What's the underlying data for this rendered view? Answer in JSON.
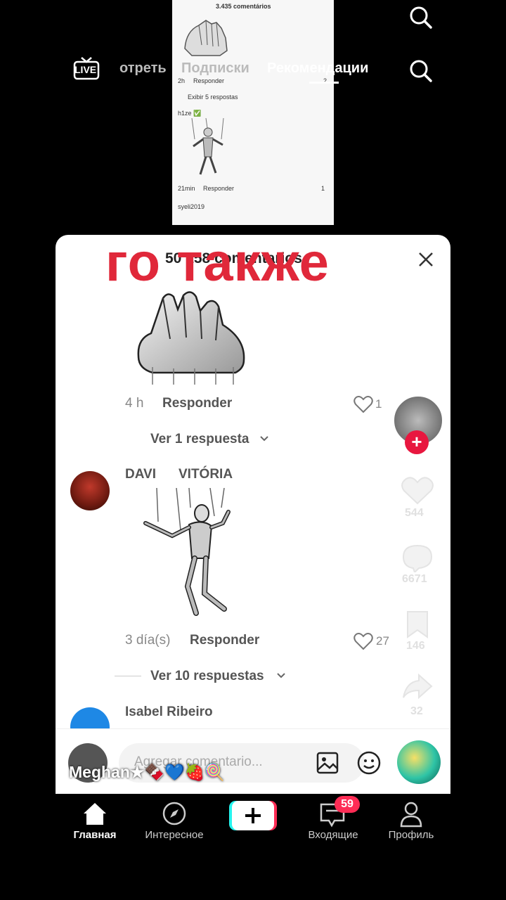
{
  "inset": {
    "title": "3.435 comentários",
    "row1_time": "2h",
    "row1_reply": "Responder",
    "row1_likes": "2",
    "view_replies": "Exibir 5 respostas",
    "user1": "h1ze ✅",
    "row2_time": "21min",
    "row2_reply": "Responder",
    "row2_likes": "1",
    "user2": "syeli2019"
  },
  "topnav": {
    "live_label": "LIVE",
    "tab_watch": "отреть",
    "tab_following": "Подписки",
    "tab_recommended": "Рекомендации"
  },
  "overlay_text": "го также",
  "sheet": {
    "header": "50 158 comentarios",
    "comment1": {
      "time": "4 h",
      "reply": "Responder",
      "likes": "1",
      "view_replies": "Ver 1 respuesta"
    },
    "comment2": {
      "author_a": "DAVI",
      "author_b": "VITÓRIA",
      "time": "3 día(s)",
      "reply": "Responder",
      "likes": "27",
      "view_replies": "Ver 10 respuestas"
    },
    "comment3": {
      "author": "Isabel Ribeiro"
    },
    "input_placeholder": "Agregar comentario...",
    "creator_name": "Meghan★🍫💙🍓🍭"
  },
  "side_actions": {
    "likes": "544",
    "comments": "6671",
    "saves": "146",
    "shares": "32"
  },
  "bottom_nav": {
    "home": "Главная",
    "discover": "Интересное",
    "inbox": "Входящие",
    "inbox_badge": "59",
    "profile": "Профиль"
  },
  "colors": {
    "accent_red": "#e8173f",
    "overlay_red": "#e0283a",
    "badge_red": "#fe2c55"
  }
}
